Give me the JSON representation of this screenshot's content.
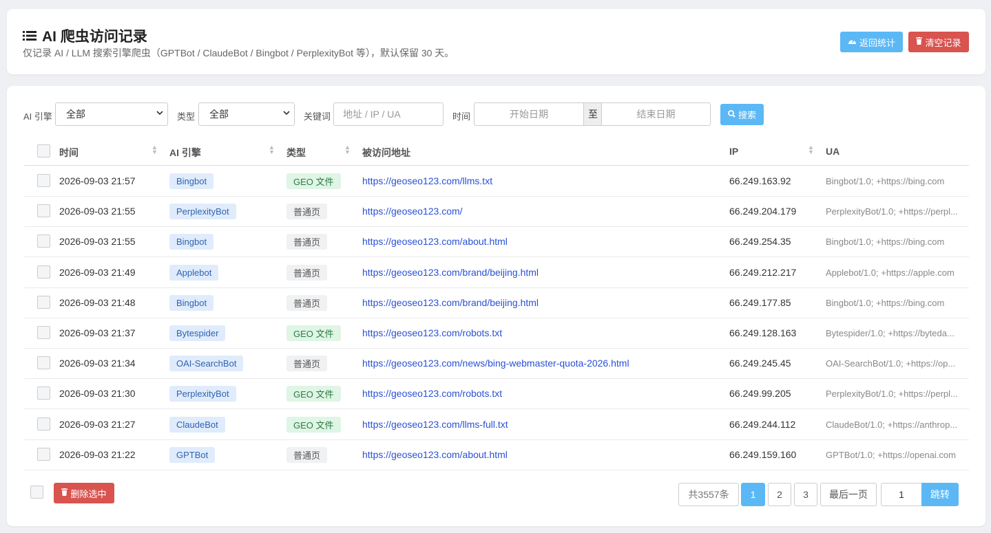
{
  "header": {
    "title": "AI 爬虫访问记录",
    "subtitle": "仅记录 AI / LLM 搜索引擎爬虫（GPTBot / ClaudeBot / Bingbot / PerplexityBot 等），默认保留 30 天。",
    "back_label": "返回统计",
    "clear_label": "清空记录",
    "title_icon": "list-icon",
    "back_icon": "dashboard-icon",
    "clear_icon": "trash-icon"
  },
  "filters": {
    "engine_label": "AI 引擎",
    "engine_value": "全部",
    "type_label": "类型",
    "type_value": "全部",
    "keyword_label": "关键词",
    "keyword_placeholder": "地址 / IP / UA",
    "time_label": "时间",
    "start_placeholder": "开始日期",
    "date_separator": "至",
    "end_placeholder": "结束日期",
    "search_label": "搜索"
  },
  "table": {
    "columns": [
      "时间",
      "AI 引擎",
      "类型",
      "被访问地址",
      "IP",
      "UA"
    ],
    "rows": [
      {
        "time": "2026-09-03 21:57",
        "engine": "Bingbot",
        "type": "GEO 文件",
        "type_kind": "geo",
        "url": "https://geoseo123.com/llms.txt",
        "ip": "66.249.163.92",
        "ua": "Bingbot/1.0; +https://bing.com"
      },
      {
        "time": "2026-09-03 21:55",
        "engine": "PerplexityBot",
        "type": "普通页",
        "type_kind": "normal",
        "url": "https://geoseo123.com/",
        "ip": "66.249.204.179",
        "ua": "PerplexityBot/1.0; +https://perpl..."
      },
      {
        "time": "2026-09-03 21:55",
        "engine": "Bingbot",
        "type": "普通页",
        "type_kind": "normal",
        "url": "https://geoseo123.com/about.html",
        "ip": "66.249.254.35",
        "ua": "Bingbot/1.0; +https://bing.com"
      },
      {
        "time": "2026-09-03 21:49",
        "engine": "Applebot",
        "type": "普通页",
        "type_kind": "normal",
        "url": "https://geoseo123.com/brand/beijing.html",
        "ip": "66.249.212.217",
        "ua": "Applebot/1.0; +https://apple.com"
      },
      {
        "time": "2026-09-03 21:48",
        "engine": "Bingbot",
        "type": "普通页",
        "type_kind": "normal",
        "url": "https://geoseo123.com/brand/beijing.html",
        "ip": "66.249.177.85",
        "ua": "Bingbot/1.0; +https://bing.com"
      },
      {
        "time": "2026-09-03 21:37",
        "engine": "Bytespider",
        "type": "GEO 文件",
        "type_kind": "geo",
        "url": "https://geoseo123.com/robots.txt",
        "ip": "66.249.128.163",
        "ua": "Bytespider/1.0; +https://byteda..."
      },
      {
        "time": "2026-09-03 21:34",
        "engine": "OAI-SearchBot",
        "type": "普通页",
        "type_kind": "normal",
        "url": "https://geoseo123.com/news/bing-webmaster-quota-2026.html",
        "ip": "66.249.245.45",
        "ua": "OAI-SearchBot/1.0; +https://op..."
      },
      {
        "time": "2026-09-03 21:30",
        "engine": "PerplexityBot",
        "type": "GEO 文件",
        "type_kind": "geo",
        "url": "https://geoseo123.com/robots.txt",
        "ip": "66.249.99.205",
        "ua": "PerplexityBot/1.0; +https://perpl..."
      },
      {
        "time": "2026-09-03 21:27",
        "engine": "ClaudeBot",
        "type": "GEO 文件",
        "type_kind": "geo",
        "url": "https://geoseo123.com/llms-full.txt",
        "ip": "66.249.244.112",
        "ua": "ClaudeBot/1.0; +https://anthrop..."
      },
      {
        "time": "2026-09-03 21:22",
        "engine": "GPTBot",
        "type": "普通页",
        "type_kind": "normal",
        "url": "https://geoseo123.com/about.html",
        "ip": "66.249.159.160",
        "ua": "GPTBot/1.0; +https://openai.com"
      }
    ]
  },
  "footer": {
    "delete_label": "删除选中",
    "total_label": "共3557条",
    "pages": [
      "1",
      "2",
      "3"
    ],
    "current_page": "1",
    "last_label": "最后一页",
    "jump_value": "1",
    "jump_label": "跳转"
  },
  "colors": {
    "accent": "#5bb8f5",
    "danger": "#d9534f",
    "link": "#2850d5"
  }
}
